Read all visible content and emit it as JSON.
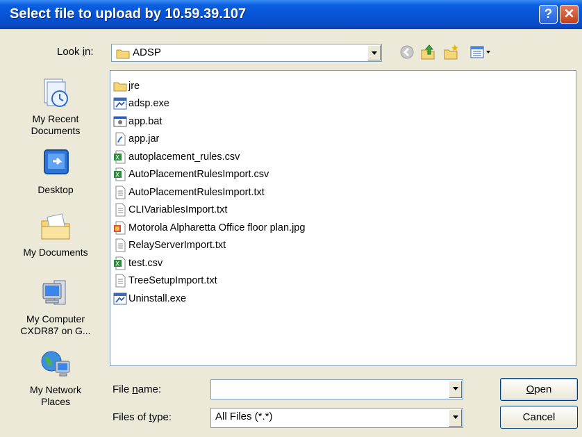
{
  "window": {
    "title": "Select file to upload by 10.59.39.107",
    "help_label": "?",
    "close_label": "✕"
  },
  "lookin": {
    "label": "Look in:",
    "value": "ADSP"
  },
  "toolbar": {
    "items": [
      "back-icon",
      "up-folder-icon",
      "new-folder-icon",
      "view-menu-icon"
    ]
  },
  "places": [
    {
      "label": "My Recent Documents",
      "icon": "recent-documents-icon"
    },
    {
      "label": "Desktop",
      "icon": "desktop-icon"
    },
    {
      "label": "My Documents",
      "icon": "my-documents-icon"
    },
    {
      "label": "My Computer CXDR87 on G...",
      "icon": "my-computer-icon"
    },
    {
      "label": "My Network Places",
      "icon": "network-places-icon"
    }
  ],
  "files": [
    {
      "name": "jre",
      "icon": "folder-icon"
    },
    {
      "name": "adsp.exe",
      "icon": "exe-icon"
    },
    {
      "name": "app.bat",
      "icon": "bat-icon"
    },
    {
      "name": "app.jar",
      "icon": "jar-icon"
    },
    {
      "name": "autoplacement_rules.csv",
      "icon": "csv-icon"
    },
    {
      "name": "AutoPlacementRulesImport.csv",
      "icon": "csv-icon"
    },
    {
      "name": "AutoPlacementRulesImport.txt",
      "icon": "txt-icon"
    },
    {
      "name": "CLIVariablesImport.txt",
      "icon": "txt-icon"
    },
    {
      "name": "Motorola Alpharetta Office floor plan.jpg",
      "icon": "jpg-icon"
    },
    {
      "name": "RelayServerImport.txt",
      "icon": "txt-icon"
    },
    {
      "name": "test.csv",
      "icon": "csv-icon"
    },
    {
      "name": "TreeSetupImport.txt",
      "icon": "txt-icon"
    },
    {
      "name": "Uninstall.exe",
      "icon": "exe-icon"
    }
  ],
  "filename": {
    "label": "File name:",
    "value": ""
  },
  "filetype": {
    "label": "Files of type:",
    "value": "All Files (*.*)"
  },
  "buttons": {
    "open": "Open",
    "cancel": "Cancel"
  },
  "colors": {
    "title_bar": "#0553D4",
    "dialog_bg": "#ECE9D8",
    "border": "#7F9DB9",
    "close": "#C4401C"
  }
}
